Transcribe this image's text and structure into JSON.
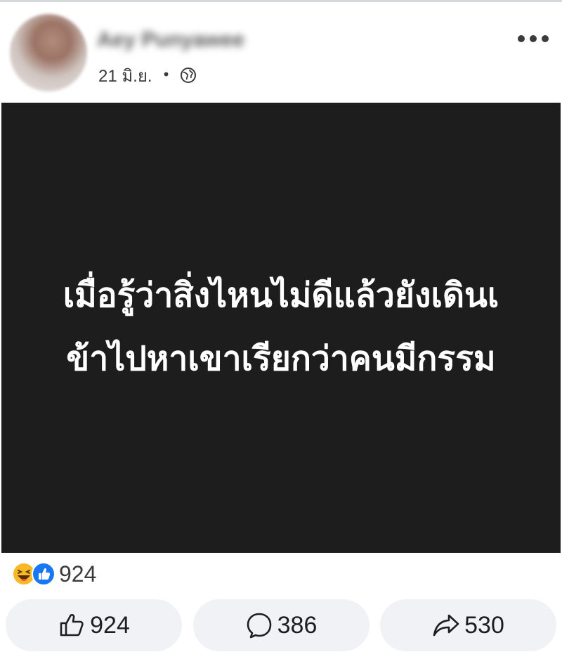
{
  "post": {
    "author_name": "Aey Punyawee",
    "date": "21 มิ.ย.",
    "separator": "•",
    "privacy_icon": "globe-icon",
    "more_icon": "more-options-icon",
    "image_text_lines": [
      "เมื่อรู้ว่าสิ่งไหนไม่ดีแล้วยังเดินเ",
      "ข้าไปหาเขาเรียกว่าคนมีกรรม"
    ],
    "image_background": "#1d1d1d",
    "reactions": {
      "icons": [
        "haha-icon",
        "like-icon"
      ],
      "count": "924"
    },
    "actions": {
      "like": {
        "icon": "thumbs-up-icon",
        "count": "924"
      },
      "comment": {
        "icon": "comment-bubble-icon",
        "count": "386"
      },
      "share": {
        "icon": "share-arrow-icon",
        "count": "530"
      }
    }
  },
  "colors": {
    "like_blue": "#1877f2",
    "haha_yellow": "#f7b928",
    "button_bg": "#f0f2f5"
  }
}
